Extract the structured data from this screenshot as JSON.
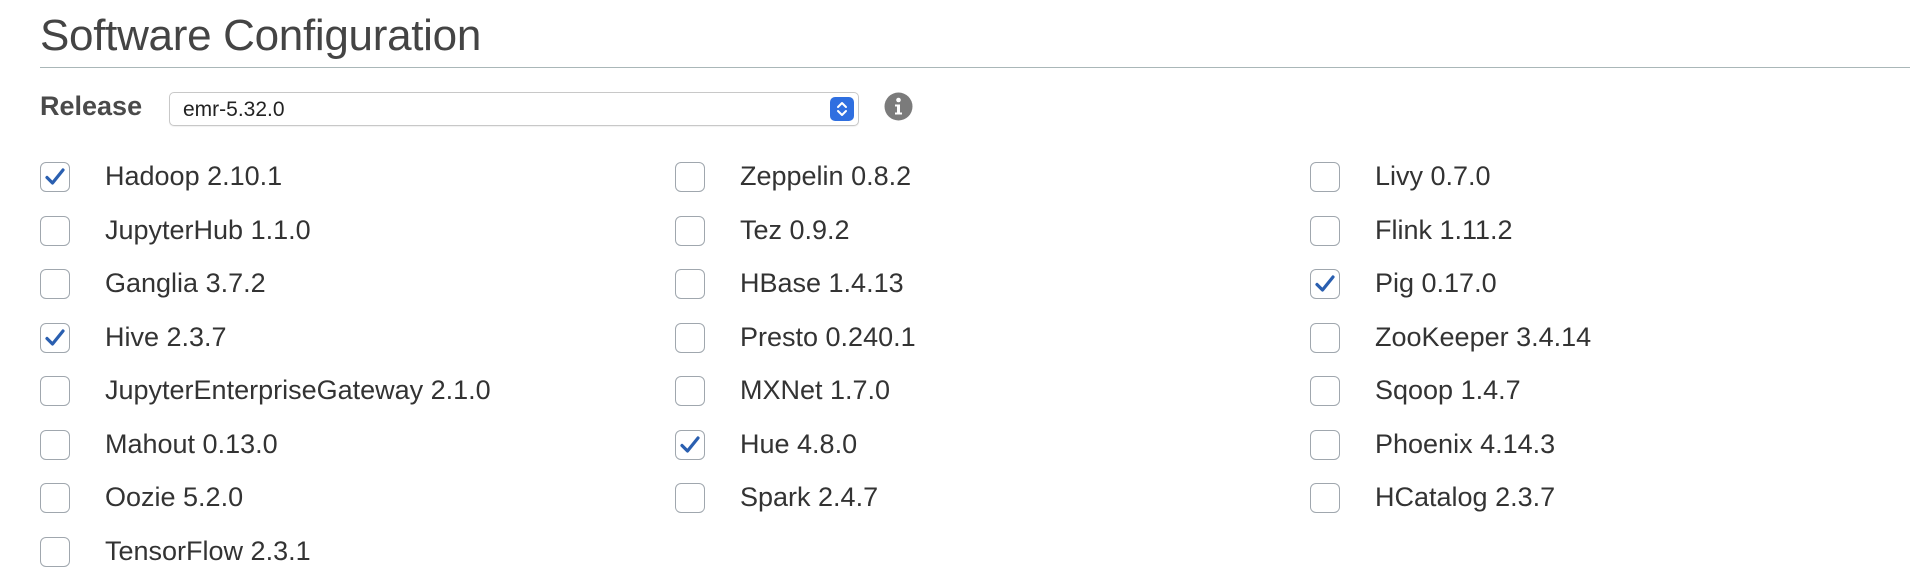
{
  "section": {
    "title": "Software Configuration"
  },
  "release": {
    "label": "Release",
    "selected": "emr-5.32.0",
    "info_icon": "info-icon"
  },
  "applications": [
    {
      "label": "Hadoop 2.10.1",
      "checked": true
    },
    {
      "label": "JupyterHub 1.1.0",
      "checked": false
    },
    {
      "label": "Ganglia 3.7.2",
      "checked": false
    },
    {
      "label": "Hive 2.3.7",
      "checked": true
    },
    {
      "label": "JupyterEnterpriseGateway 2.1.0",
      "checked": false
    },
    {
      "label": "Mahout 0.13.0",
      "checked": false
    },
    {
      "label": "Oozie 5.2.0",
      "checked": false
    },
    {
      "label": "TensorFlow 2.3.1",
      "checked": false
    },
    {
      "label": "Zeppelin 0.8.2",
      "checked": false
    },
    {
      "label": "Tez 0.9.2",
      "checked": false
    },
    {
      "label": "HBase 1.4.13",
      "checked": false
    },
    {
      "label": "Presto 0.240.1",
      "checked": false
    },
    {
      "label": "MXNet 1.7.0",
      "checked": false
    },
    {
      "label": "Hue 4.8.0",
      "checked": true
    },
    {
      "label": "Spark 2.4.7",
      "checked": false
    },
    {
      "label": "Livy 0.7.0",
      "checked": false
    },
    {
      "label": "Flink 1.11.2",
      "checked": false
    },
    {
      "label": "Pig 0.17.0",
      "checked": true
    },
    {
      "label": "ZooKeeper 3.4.14",
      "checked": false
    },
    {
      "label": "Sqoop 1.4.7",
      "checked": false
    },
    {
      "label": "Phoenix 4.14.3",
      "checked": false
    },
    {
      "label": "HCatalog 2.3.7",
      "checked": false
    }
  ],
  "colors": {
    "checkmark": "#2a5fb0",
    "select_arrow_bg": "#2f6fe0",
    "rule": "#aab7b8"
  }
}
